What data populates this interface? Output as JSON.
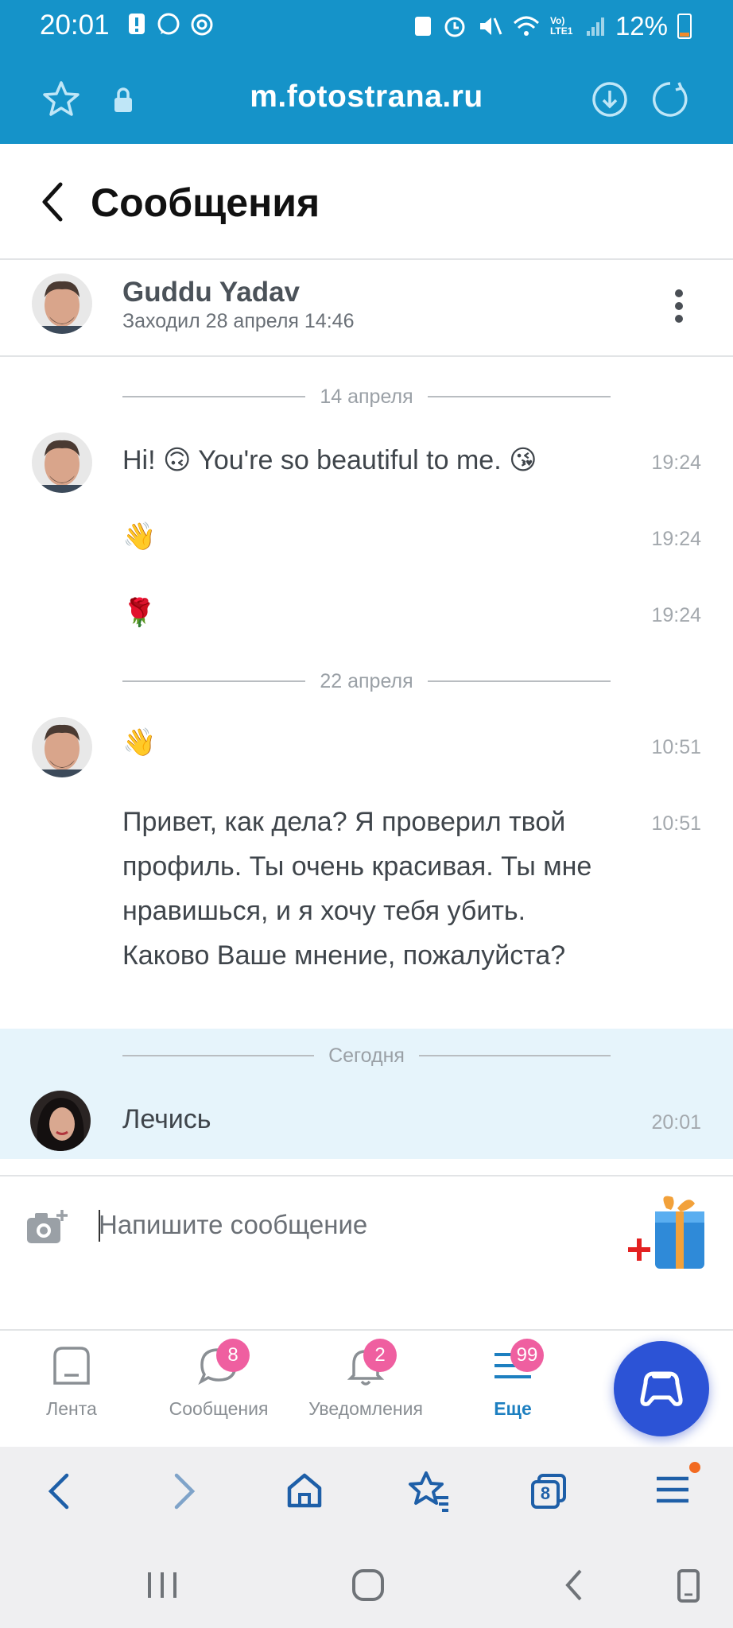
{
  "status_bar": {
    "time": "20:01",
    "battery": "12%",
    "network_label": "Vo) LTE1"
  },
  "browser": {
    "url": "m.fotostrana.ru",
    "tab_count": "8"
  },
  "page": {
    "title": "Сообщения"
  },
  "contact": {
    "name": "Guddu Yadav",
    "status": "Заходил 28 апреля 14:46"
  },
  "date_separators": [
    "14 апреля",
    "22 апреля",
    "Сегодня"
  ],
  "messages": [
    {
      "text": "Hi! 🙃 You're so beautiful to me. 😘",
      "time": "19:24"
    },
    {
      "text": "👋",
      "time": "19:24"
    },
    {
      "text": "🌹",
      "time": "19:24"
    },
    {
      "text": "👋",
      "time": "10:51"
    },
    {
      "text": "Привет, как дела? Я проверил твой профиль. Ты очень красивая. Ты мне нравишься, и я хочу тебя убить. Каково Ваше мнение, пожалуйста?",
      "time": "10:51"
    },
    {
      "text": "Лечись",
      "time": "20:01"
    }
  ],
  "composer": {
    "placeholder": "Напишите сообщение"
  },
  "bottom_nav": [
    {
      "label": "Лента",
      "badge": ""
    },
    {
      "label": "Сообщения",
      "badge": "8"
    },
    {
      "label": "Уведомления",
      "badge": "2"
    },
    {
      "label": "Еще",
      "badge": "99"
    }
  ],
  "colors": {
    "brand": "#1593c9",
    "badge": "#ef5fa0",
    "fab": "#2c53d6",
    "today_band": "#e6f4fb"
  }
}
